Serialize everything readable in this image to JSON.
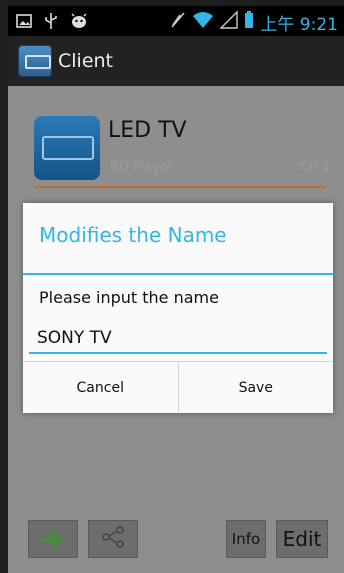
{
  "status_bar": {
    "left_icons": [
      "image-icon",
      "usb-icon",
      "android-debug-icon"
    ],
    "right_icons": [
      "mute-icon",
      "wifi-icon",
      "signal-icon",
      "battery-icon"
    ],
    "time": "上午 9:21"
  },
  "action_bar": {
    "title": "Client",
    "icon": "app-icon"
  },
  "device_list": [
    {
      "name": "LED TV",
      "subtitle": "BD Player",
      "channel": "Ch 1"
    }
  ],
  "bottom_bar": {
    "add_icon": "plus-icon",
    "share_icon": "share-icon",
    "info_label": "Info",
    "edit_label": "Edit"
  },
  "dialog": {
    "title": "Modifies the Name",
    "message": "Please input the name",
    "input_value": "SONY TV",
    "cancel_label": "Cancel",
    "save_label": "Save"
  },
  "colors": {
    "accent": "#33b5e5",
    "divider": "#b8702a",
    "add_green": "#3b9b2a"
  }
}
